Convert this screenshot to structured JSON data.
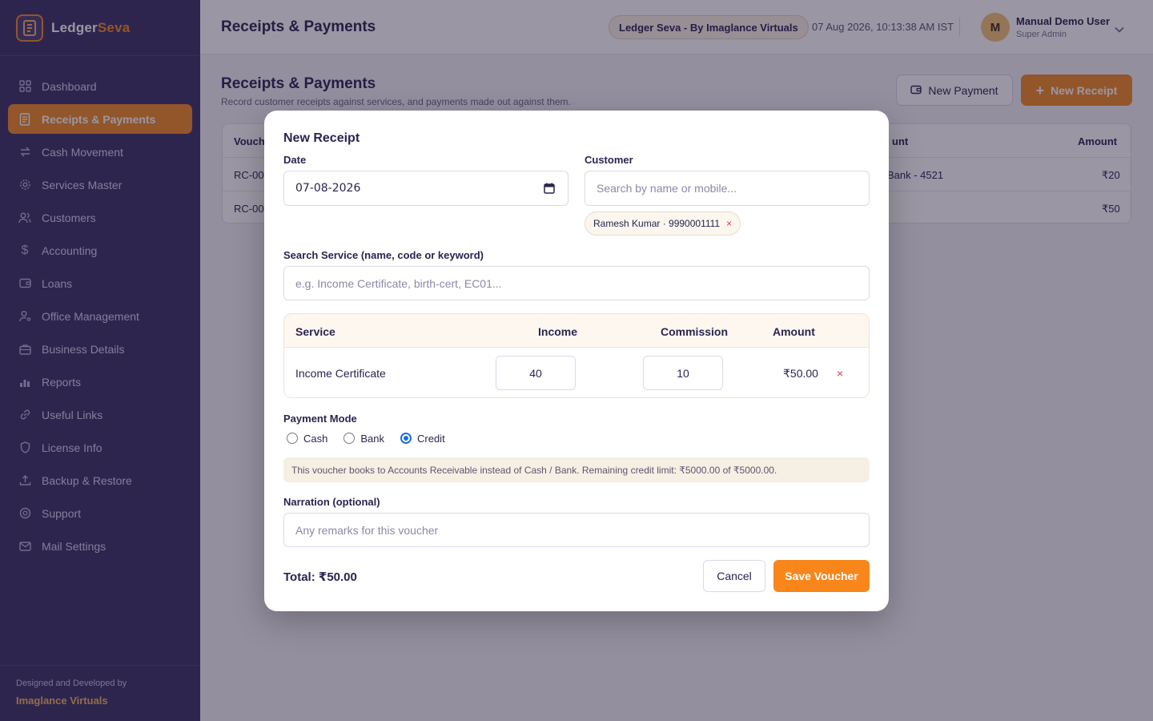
{
  "brand": {
    "name_a": "Ledger",
    "name_b": "Seva"
  },
  "sidebar": {
    "items": [
      {
        "label": "Dashboard",
        "icon": "grid-icon"
      },
      {
        "label": "Receipts & Payments",
        "icon": "receipt-icon",
        "active": true
      },
      {
        "label": "Cash Movement",
        "icon": "swap-icon"
      },
      {
        "label": "Services Master",
        "icon": "gear-icon"
      },
      {
        "label": "Customers",
        "icon": "users-icon"
      },
      {
        "label": "Accounting",
        "icon": "dollar-icon"
      },
      {
        "label": "Loans",
        "icon": "wallet-icon"
      },
      {
        "label": "Office Management",
        "icon": "user-cog-icon"
      },
      {
        "label": "Business Details",
        "icon": "briefcase-icon"
      },
      {
        "label": "Reports",
        "icon": "bar-chart-icon"
      },
      {
        "label": "Useful Links",
        "icon": "link-icon"
      },
      {
        "label": "License Info",
        "icon": "shield-icon"
      },
      {
        "label": "Backup & Restore",
        "icon": "upload-icon"
      },
      {
        "label": "Support",
        "icon": "help-icon"
      },
      {
        "label": "Mail Settings",
        "icon": "mail-icon"
      }
    ],
    "footer_small": "Designed and Developed by",
    "footer_big": "Imaglance Virtuals"
  },
  "topbar": {
    "title": "Receipts & Payments",
    "badge": "Ledger Seva - By Imaglance Virtuals",
    "datetime": "07 Aug 2026, 10:13:38 AM IST",
    "avatar_initial": "M",
    "user_name": "Manual Demo User",
    "user_role": "Super Admin"
  },
  "page": {
    "title": "Receipts & Payments",
    "subtitle": "Record customer receipts against services, and payments made out against them.",
    "new_payment": "New Payment",
    "new_receipt": "New Receipt",
    "table": {
      "head_voucher": "Vouch",
      "head_account": "unt",
      "head_amount": "Amount",
      "rows": [
        {
          "voucher": "RC-00",
          "account": "Bank - 4521",
          "amount": "₹20"
        },
        {
          "voucher": "RC-00",
          "account": "",
          "amount": "₹50"
        }
      ]
    }
  },
  "modal": {
    "title": "New Receipt",
    "date_label": "Date",
    "date_value": "07-08-2026",
    "customer_label": "Customer",
    "customer_placeholder": "Search by name or mobile...",
    "customer_chip": "Ramesh Kumar · 9990001111",
    "service_search_label": "Search Service (name, code or keyword)",
    "service_search_placeholder": "e.g. Income Certificate, birth-cert, EC01...",
    "table": {
      "headers": {
        "service": "Service",
        "income": "Income",
        "commission": "Commission",
        "amount": "Amount"
      },
      "rows": [
        {
          "service": "Income Certificate",
          "income": "40",
          "commission": "10",
          "amount": "₹50.00"
        }
      ]
    },
    "payment_mode_label": "Payment Mode",
    "payment_modes": [
      {
        "label": "Cash",
        "selected": false
      },
      {
        "label": "Bank",
        "selected": false
      },
      {
        "label": "Credit",
        "selected": true
      }
    ],
    "credit_note": "This voucher books to Accounts Receivable instead of Cash / Bank. Remaining credit limit: ₹5000.00 of ₹5000.00.",
    "narration_label": "Narration (optional)",
    "narration_placeholder": "Any remarks for this voucher",
    "total": "Total: ₹50.00",
    "cancel": "Cancel",
    "save": "Save Voucher"
  },
  "colors": {
    "sidebar_bg": "#3b3266",
    "accent": "#f08a24",
    "save_button": "#f8861a",
    "remove": "#d23c3c",
    "radio_selected": "#1a6fe0"
  }
}
